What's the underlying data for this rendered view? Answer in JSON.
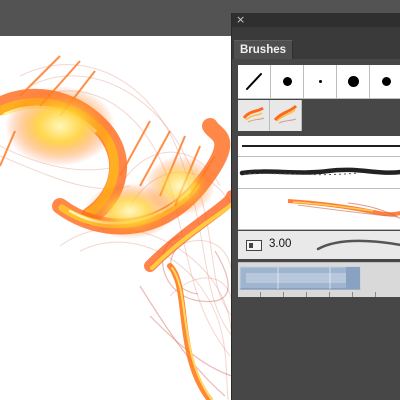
{
  "panel": {
    "title": "Brushes",
    "close_glyph": "×",
    "size_value": "3.00",
    "brush_tips": [
      {
        "kind": "calligraphic",
        "name": "calligraphic-brush-icon"
      },
      {
        "kind": "round-medium",
        "name": "round-brush-icon"
      },
      {
        "kind": "round-small",
        "name": "small-round-brush-icon"
      },
      {
        "kind": "round-large",
        "name": "large-round-brush-icon"
      },
      {
        "kind": "round-medium",
        "name": "round-brush-icon"
      }
    ],
    "scatter_swatches": 2,
    "colors": {
      "panel_bg": "#474747",
      "flame_orange": "#ff6a1a",
      "flame_yellow": "#ffe040",
      "pattern_blue": "#9fb4cf"
    }
  }
}
